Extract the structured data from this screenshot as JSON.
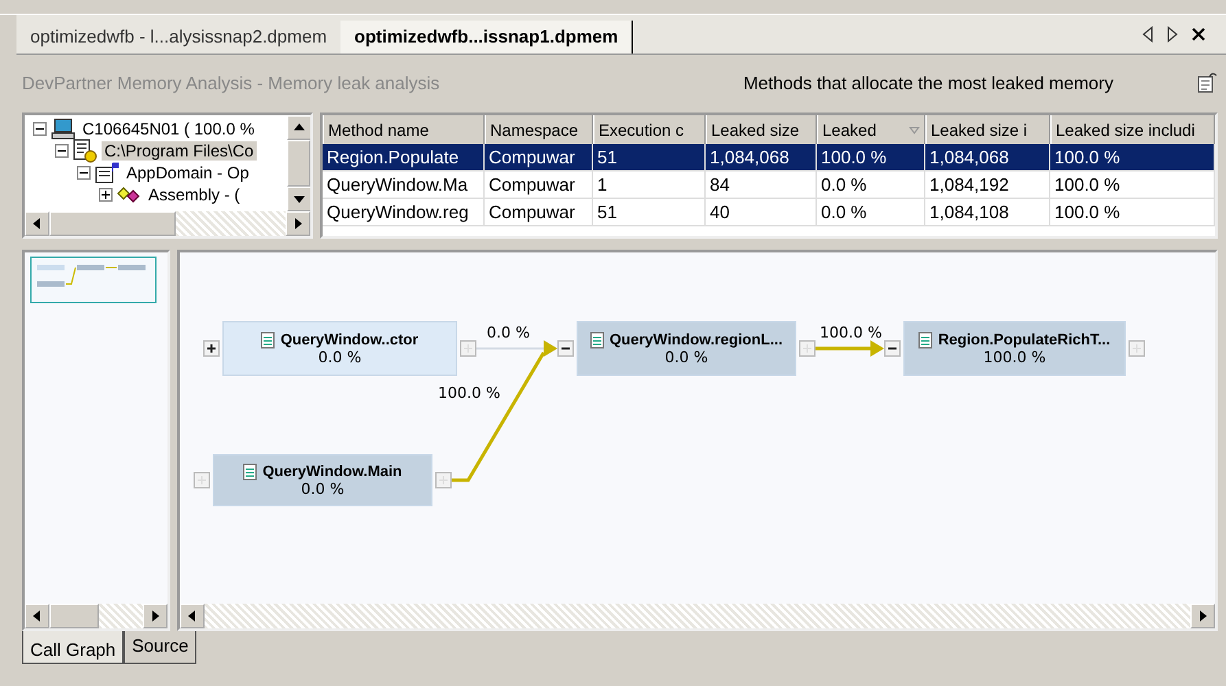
{
  "document_tabs": [
    {
      "label": "optimizedwfb - l...alysissnap2.dpmem",
      "selected": false
    },
    {
      "label": "optimizedwfb...issnap1.dpmem",
      "selected": true
    }
  ],
  "header": {
    "title": "DevPartner Memory Analysis - Memory leak analysis",
    "subtitle": "Methods that allocate the most leaked memory"
  },
  "tree": [
    {
      "label": "C106645N01 ( 100.0 %",
      "kind": "computer",
      "selected": false,
      "expanded": true,
      "children": [
        {
          "label": "C:\\Program Files\\Co",
          "kind": "process",
          "selected": true,
          "expanded": true,
          "children": [
            {
              "label": "AppDomain - Op",
              "kind": "appdomain",
              "selected": false,
              "expanded": true,
              "children": [
                {
                  "label": "Assembly - (",
                  "kind": "assembly",
                  "selected": false,
                  "expanded": false
                }
              ]
            }
          ]
        }
      ]
    }
  ],
  "table": {
    "columns": [
      {
        "label": "Method name",
        "sorted": false
      },
      {
        "label": "Namespace",
        "sorted": false
      },
      {
        "label": "Execution c",
        "sorted": false
      },
      {
        "label": "Leaked size",
        "sorted": false
      },
      {
        "label": "Leaked",
        "sorted": true
      },
      {
        "label": "Leaked size i",
        "sorted": false
      },
      {
        "label": "Leaked size includi",
        "sorted": false
      }
    ],
    "rows": [
      {
        "selected": true,
        "cells": [
          "Region.Populate",
          "Compuwar",
          "51",
          "1,084,068",
          "100.0 %",
          "1,084,068",
          "100.0 %"
        ]
      },
      {
        "selected": false,
        "cells": [
          "QueryWindow.Ma",
          "Compuwar",
          "1",
          "84",
          "0.0 %",
          "1,084,192",
          "100.0 %"
        ]
      },
      {
        "selected": false,
        "cells": [
          "QueryWindow.reg",
          "Compuwar",
          "51",
          "40",
          "0.0 %",
          "1,084,108",
          "100.0 %"
        ]
      }
    ]
  },
  "call_graph": {
    "nodes": [
      {
        "name": "QueryWindow..ctor",
        "percent": "0.0 %",
        "on_path": false,
        "expandable": true,
        "expanded": false
      },
      {
        "name": "QueryWindow.Main",
        "percent": "0.0 %",
        "on_path": true,
        "expandable": false,
        "expanded": false
      },
      {
        "name": "QueryWindow.regionL...",
        "percent": "0.0 %",
        "on_path": true,
        "expandable": true,
        "expanded": true
      },
      {
        "name": "Region.PopulateRichT...",
        "percent": "100.0 %",
        "on_path": true,
        "expandable": true,
        "expanded": true
      }
    ],
    "edges": [
      {
        "label": "0.0 %",
        "on_path": false
      },
      {
        "label": "100.0 %",
        "on_path": true
      },
      {
        "label": "100.0 %",
        "on_path": true
      }
    ]
  },
  "bottom_tabs": [
    {
      "label": "Call Graph",
      "selected": true
    },
    {
      "label": "Source",
      "selected": false
    }
  ]
}
